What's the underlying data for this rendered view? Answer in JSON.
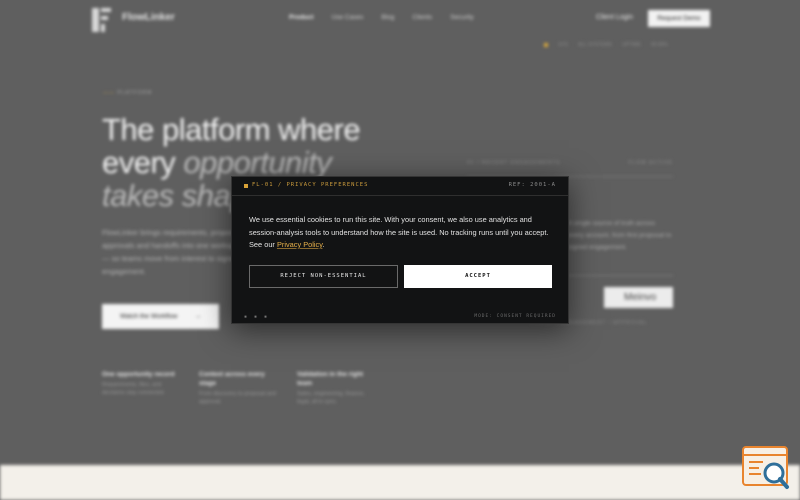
{
  "nav": {
    "brand": "FlowLinker",
    "links": [
      "Product",
      "Use Cases",
      "Blog",
      "Clients",
      "Security"
    ],
    "client_login": "Client Login",
    "request_demo": "Request Demo"
  },
  "status_strip": [
    "●",
    "SYS",
    "ALL SYSTEMS",
    "UPTIME",
    "99.99%"
  ],
  "hero": {
    "eyebrow_accent": "——",
    "eyebrow": "PLATFORM",
    "title_line1": "The platform where",
    "title_line2_a": "every ",
    "title_line2_b": "opportunity",
    "title_line3": "takes shape",
    "copy": "FlowLinker brings requirements, proposals, approvals and handoffs into one workspace — so teams move from interest to signed engagement.",
    "watch_button": "Watch the Workflow",
    "watch_arrow": "→",
    "features": [
      {
        "title": "One opportunity record",
        "desc": "Requirements, files, and decisions stay connected."
      },
      {
        "title": "Context across every stage",
        "desc": "From discovery to proposal and approval."
      },
      {
        "title": "Validation in the right team",
        "desc": "Sales, engineering, finance, legal, all in sync."
      }
    ]
  },
  "panel": {
    "head_left": "01 / RECENT ENGAGEMENTS",
    "head_right": "FLOW ACTIVE",
    "copy": "A single source of truth across every account, from first proposal to signed engagement.",
    "logo": "Meinvo",
    "foot": "CLIENT / ENGAGEMENT / APPROVAL"
  },
  "cookie": {
    "tag": "FL-01 / PRIVACY PREFERENCES",
    "ref": "REF: 2001-A",
    "body_text": "We use essential cookies to run this site. With your consent, we also use analytics and session-analysis tools to understand how the site is used. No tracking runs until you accept. See our ",
    "policy_link": "Privacy Policy",
    "body_end": ".",
    "reject_label": "REJECT NON-ESSENTIAL",
    "accept_label": "ACCEPT",
    "foot_left": "▪ ▪ ▪",
    "foot_right": "MODE: CONSENT REQUIRED"
  },
  "colors": {
    "accent": "#d8a238",
    "overlay": "#5f5f5f",
    "modal_bg": "#121314",
    "widget_orange": "#e8842e",
    "widget_blue": "#2f6f9a"
  },
  "widget": {
    "icon": "search-icon"
  }
}
